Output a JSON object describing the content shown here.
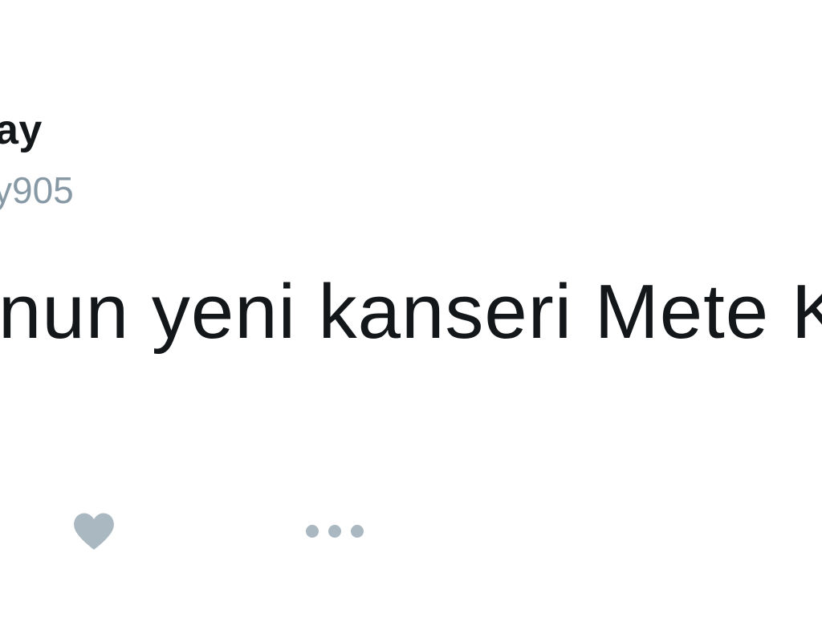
{
  "tweet": {
    "display_name": "ay",
    "handle": "y905",
    "text": "nun yeni kanseri Mete K"
  },
  "actions": {
    "like_icon": "heart-icon",
    "more_icon": "more-options-icon"
  },
  "colors": {
    "text_primary": "#14171a",
    "text_secondary": "#8899a6",
    "icon": "#aab8c2",
    "background": "#ffffff"
  }
}
